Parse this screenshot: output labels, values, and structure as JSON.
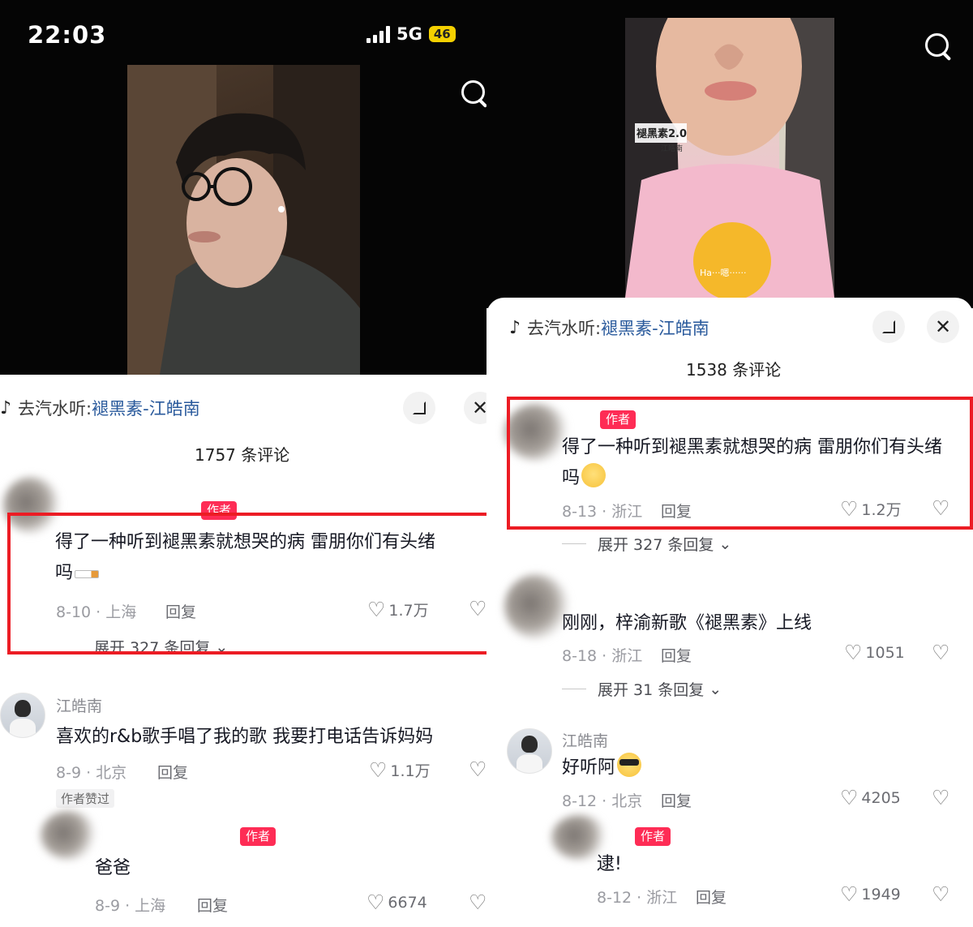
{
  "left": {
    "status": {
      "time": "22:03",
      "network": "5G",
      "battery": "46"
    },
    "music": {
      "prefix": "去汽水听:",
      "link": "褪黑素-江皓南"
    },
    "comment_count": "1757 条评论",
    "comments": [
      {
        "badge": "作者",
        "text_line1": "得了一种听到褪黑素就想哭的病 雷朋你们有头绪",
        "text_line2": "吗",
        "date": "8-10 · 上海",
        "reply": "回复",
        "likes": "1.7万",
        "more_replies": "展开 327 条回复"
      },
      {
        "username": "江皓南",
        "text": "喜欢的r&b歌手唱了我的歌 我要打电话告诉妈妈",
        "date": "8-9 · 北京",
        "reply": "回复",
        "likes": "1.1万",
        "tag": "作者赞过"
      },
      {
        "badge": "作者",
        "text": "爸爸",
        "date": "8-9 · 上海",
        "reply": "回复",
        "likes": "6674"
      }
    ]
  },
  "right": {
    "video_title": "褪黑素2.0",
    "video_subtitle": "江皓南",
    "video_caption": "Ha···嗯······",
    "music": {
      "prefix": "去汽水听:",
      "link": "褪黑素-江皓南"
    },
    "comment_count": "1538 条评论",
    "comments": [
      {
        "badge": "作者",
        "text_line1": "得了一种听到褪黑素就想哭的病 雷朋你们有头绪",
        "text_line2": "吗",
        "date": "8-13 · 浙江",
        "reply": "回复",
        "likes": "1.2万",
        "more_replies": "展开 327 条回复"
      },
      {
        "text": "刚刚，梓渝新歌《褪黑素》上线",
        "date": "8-18 · 浙江",
        "reply": "回复",
        "likes": "1051",
        "more_replies": "展开 31 条回复"
      },
      {
        "username": "江皓南",
        "text": "好听阿",
        "date": "8-12 · 北京",
        "reply": "回复",
        "likes": "4205"
      },
      {
        "badge": "作者",
        "text": "逮!",
        "date": "8-12 · 浙江",
        "reply": "回复",
        "likes": "1949"
      }
    ]
  },
  "colors": {
    "highlight": "#ec1c24",
    "author_badge": "#fe2c55",
    "music_link": "#2a5a9c"
  }
}
